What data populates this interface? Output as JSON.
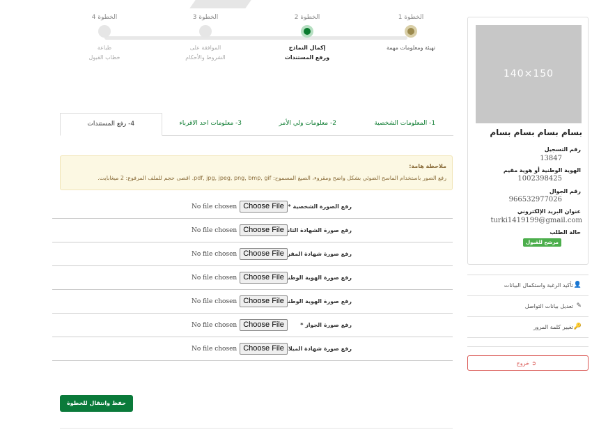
{
  "steps": [
    {
      "num": "الخطوة 1",
      "label1": "تهيئة ومعلومات مهمة",
      "label2": ""
    },
    {
      "num": "الخطوة 2",
      "label1": "إكمال النماذج",
      "label2": "ورفع المستندات"
    },
    {
      "num": "الخطوة 3",
      "label1": "الموافقة على",
      "label2": "الشروط والأحكام"
    },
    {
      "num": "الخطوة 4",
      "label1": "طباعة",
      "label2": "خطاب القبول"
    }
  ],
  "tabs": [
    "1- المعلومات الشخصية",
    "2- معلومات ولي الأمر",
    "3- معلومات احد الاقرباء",
    "4- رفع المستندات"
  ],
  "note": {
    "title": "ملاحظة هامة:",
    "body": "رفع الصور باستخدام الماسح الضوئي بشكل واضح ومقروء، الصيغ المسموح: pdf, jpg, jpeg, png, bmp, gif. اقصى حجم للملف المرفوع: 2 ميغابايت."
  },
  "uploads": [
    {
      "label": "رفع الصورة الشخصية *"
    },
    {
      "label": "رفع صورة الشهادة الثانوية *"
    },
    {
      "label": "رفع صورة شهادة المقررات (إن وجدت)"
    },
    {
      "label": "رفع صورة الهوية الوطنية أو هوية مقيم *"
    },
    {
      "label": "رفع صورة الهوية الوطنية للأم *"
    },
    {
      "label": "رفع صورة الجواز *"
    },
    {
      "label": "رفع صورة شهادة الميلاد *"
    }
  ],
  "file_input": {
    "choose": "Choose File",
    "none": "No file chosen"
  },
  "save_button": "حفظ وانتقال للخطوة التالية",
  "profile": {
    "photo_placeholder": "150×140",
    "name": "بسام بسام بسام بسام",
    "reg_label": "رقم التسجيل",
    "reg_value": "13847",
    "id_label": "الهوية الوطنية أو هوية مقيم",
    "id_value": "1002398425",
    "mobile_label": "رقم الجوال",
    "mobile_value": "966532977026",
    "email_label": "عنوان البريد الإلكتروني",
    "email_value": "turki1419199@gmail.com",
    "status_label": "حالة الطلب",
    "status_badge": "مرشح للقبول"
  },
  "menu": [
    {
      "icon": "user-icon",
      "label": "تأكيد الرغبة واستكمال البيانات"
    },
    {
      "icon": "edit-icon",
      "label": "تعديل بيانات التواصل"
    },
    {
      "icon": "key-icon",
      "label": "تغيير كلمة المرور"
    }
  ],
  "logout_label": "خروج",
  "colors": {
    "primary": "#0a7a3a",
    "danger": "#d9534f",
    "note_bg": "#fcf8e3"
  }
}
